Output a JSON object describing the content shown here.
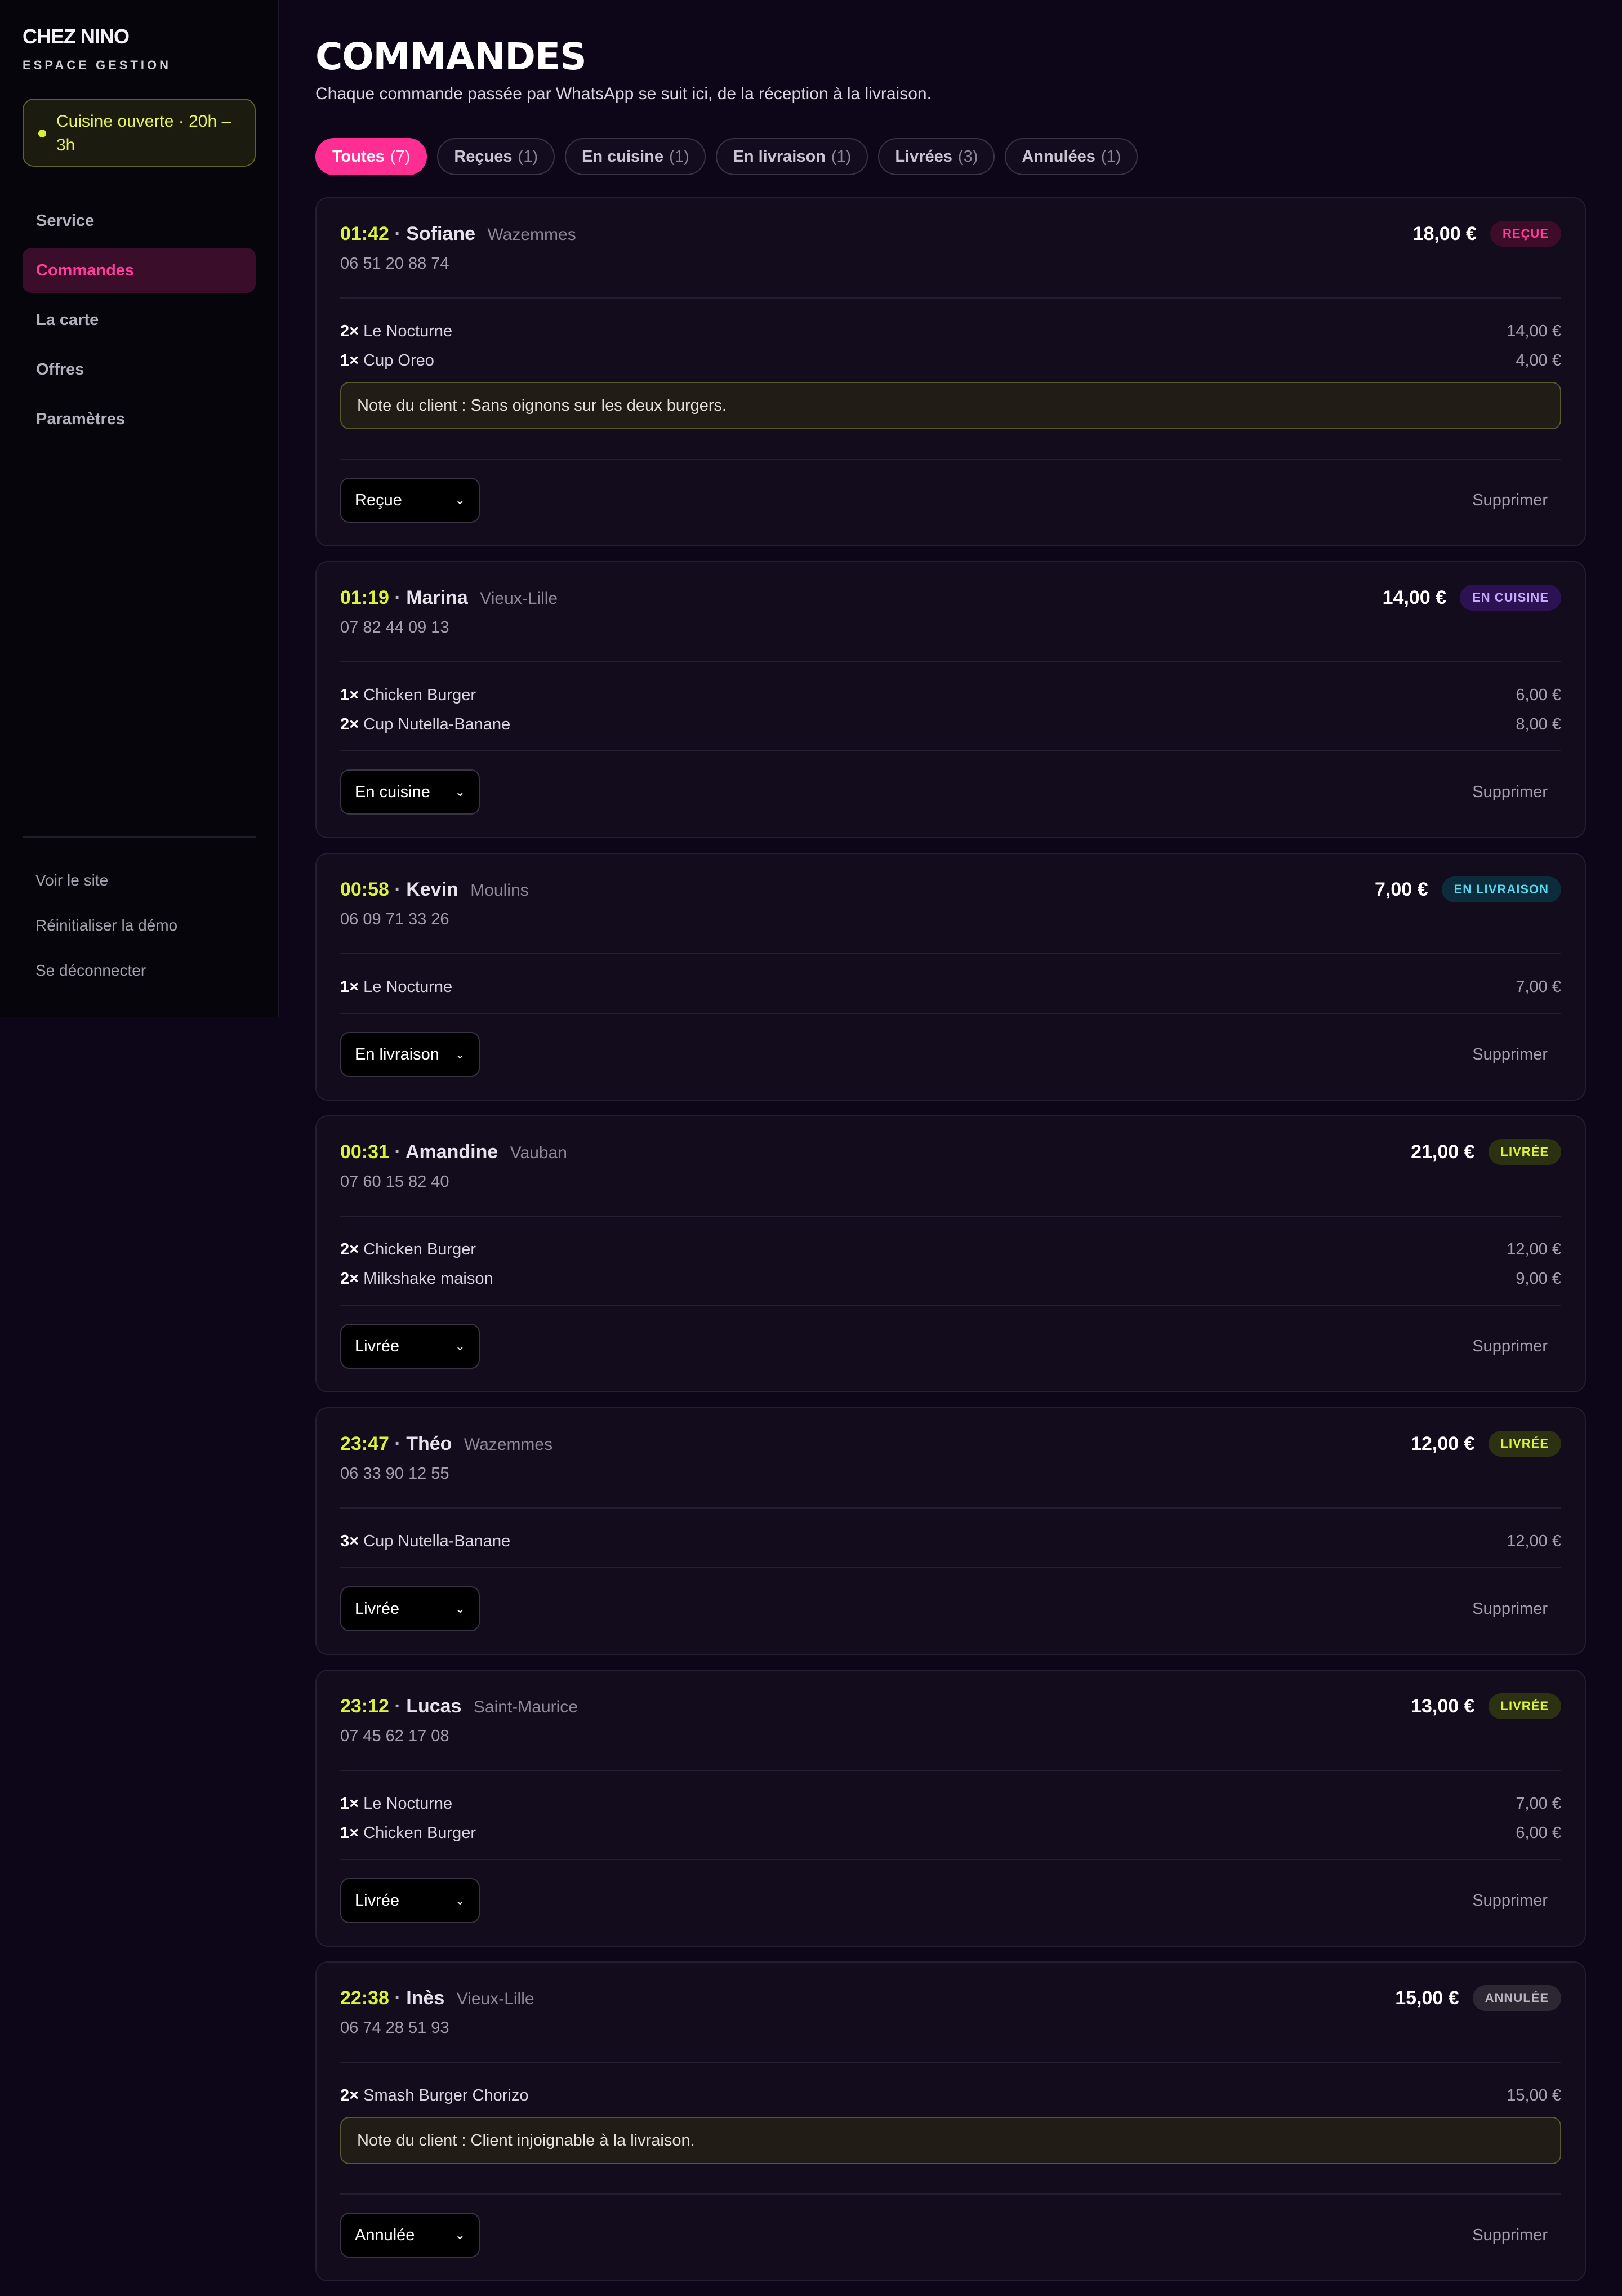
{
  "sidebar": {
    "brand": "CHEZ NINO",
    "brand_sub": "ESPACE GESTION",
    "kitchen_status": "Cuisine ouverte · 20h – 3h",
    "nav": [
      {
        "label": "Service",
        "active": false
      },
      {
        "label": "Commandes",
        "active": true
      },
      {
        "label": "La carte",
        "active": false
      },
      {
        "label": "Offres",
        "active": false
      },
      {
        "label": "Paramètres",
        "active": false
      }
    ],
    "links": [
      "Voir le site",
      "Réinitialiser la démo",
      "Se déconnecter"
    ]
  },
  "header": {
    "title": "COMMANDES",
    "subtitle": "Chaque commande passée par WhatsApp se suit ici, de la réception à la livraison."
  },
  "tabs": [
    {
      "label": "Toutes",
      "count": "(7)",
      "active": true
    },
    {
      "label": "Reçues",
      "count": "(1)",
      "active": false
    },
    {
      "label": "En cuisine",
      "count": "(1)",
      "active": false
    },
    {
      "label": "En livraison",
      "count": "(1)",
      "active": false
    },
    {
      "label": "Livrées",
      "count": "(3)",
      "active": false
    },
    {
      "label": "Annulées",
      "count": "(1)",
      "active": false
    }
  ],
  "orders": [
    {
      "time": "01:42",
      "sep": "·",
      "name": "Sofiane",
      "area": "Wazemmes",
      "phone": "06 51 20 88 74",
      "total": "18,00 €",
      "status_badge": "REÇUE",
      "status_class": "recue",
      "items": [
        {
          "qty": "2×",
          "name": "Le Nocturne",
          "price": "14,00 €"
        },
        {
          "qty": "1×",
          "name": "Cup Oreo",
          "price": "4,00 €"
        }
      ],
      "note": "Note du client : Sans oignons sur les deux burgers.",
      "select_value": "Reçue",
      "delete_label": "Supprimer"
    },
    {
      "time": "01:19",
      "sep": "·",
      "name": "Marina",
      "area": "Vieux-Lille",
      "phone": "07 82 44 09 13",
      "total": "14,00 €",
      "status_badge": "EN CUISINE",
      "status_class": "cuisine",
      "items": [
        {
          "qty": "1×",
          "name": "Chicken Burger",
          "price": "6,00 €"
        },
        {
          "qty": "2×",
          "name": "Cup Nutella-Banane",
          "price": "8,00 €"
        }
      ],
      "note": "",
      "select_value": "En cuisine",
      "delete_label": "Supprimer"
    },
    {
      "time": "00:58",
      "sep": "·",
      "name": "Kevin",
      "area": "Moulins",
      "phone": "06 09 71 33 26",
      "total": "7,00 €",
      "status_badge": "EN LIVRAISON",
      "status_class": "livraison",
      "items": [
        {
          "qty": "1×",
          "name": "Le Nocturne",
          "price": "7,00 €"
        }
      ],
      "note": "",
      "select_value": "En livraison",
      "delete_label": "Supprimer"
    },
    {
      "time": "00:31",
      "sep": "·",
      "name": "Amandine",
      "area": "Vauban",
      "phone": "07 60 15 82 40",
      "total": "21,00 €",
      "status_badge": "LIVRÉE",
      "status_class": "livree",
      "items": [
        {
          "qty": "2×",
          "name": "Chicken Burger",
          "price": "12,00 €"
        },
        {
          "qty": "2×",
          "name": "Milkshake maison",
          "price": "9,00 €"
        }
      ],
      "note": "",
      "select_value": "Livrée",
      "delete_label": "Supprimer"
    },
    {
      "time": "23:47",
      "sep": "·",
      "name": "Théo",
      "area": "Wazemmes",
      "phone": "06 33 90 12 55",
      "total": "12,00 €",
      "status_badge": "LIVRÉE",
      "status_class": "livree",
      "items": [
        {
          "qty": "3×",
          "name": "Cup Nutella-Banane",
          "price": "12,00 €"
        }
      ],
      "note": "",
      "select_value": "Livrée",
      "delete_label": "Supprimer"
    },
    {
      "time": "23:12",
      "sep": "·",
      "name": "Lucas",
      "area": "Saint-Maurice",
      "phone": "07 45 62 17 08",
      "total": "13,00 €",
      "status_badge": "LIVRÉE",
      "status_class": "livree",
      "items": [
        {
          "qty": "1×",
          "name": "Le Nocturne",
          "price": "7,00 €"
        },
        {
          "qty": "1×",
          "name": "Chicken Burger",
          "price": "6,00 €"
        }
      ],
      "note": "",
      "select_value": "Livrée",
      "delete_label": "Supprimer"
    },
    {
      "time": "22:38",
      "sep": "·",
      "name": "Inès",
      "area": "Vieux-Lille",
      "phone": "06 74 28 51 93",
      "total": "15,00 €",
      "status_badge": "ANNULÉE",
      "status_class": "annulee",
      "items": [
        {
          "qty": "2×",
          "name": "Smash Burger Chorizo",
          "price": "15,00 €"
        }
      ],
      "note": "Note du client : Client injoignable à la livraison.",
      "select_value": "Annulée",
      "delete_label": "Supprimer"
    }
  ],
  "colors": {
    "accent": "#ff2e93",
    "time": "#daf23a",
    "background": "#0c0618"
  }
}
